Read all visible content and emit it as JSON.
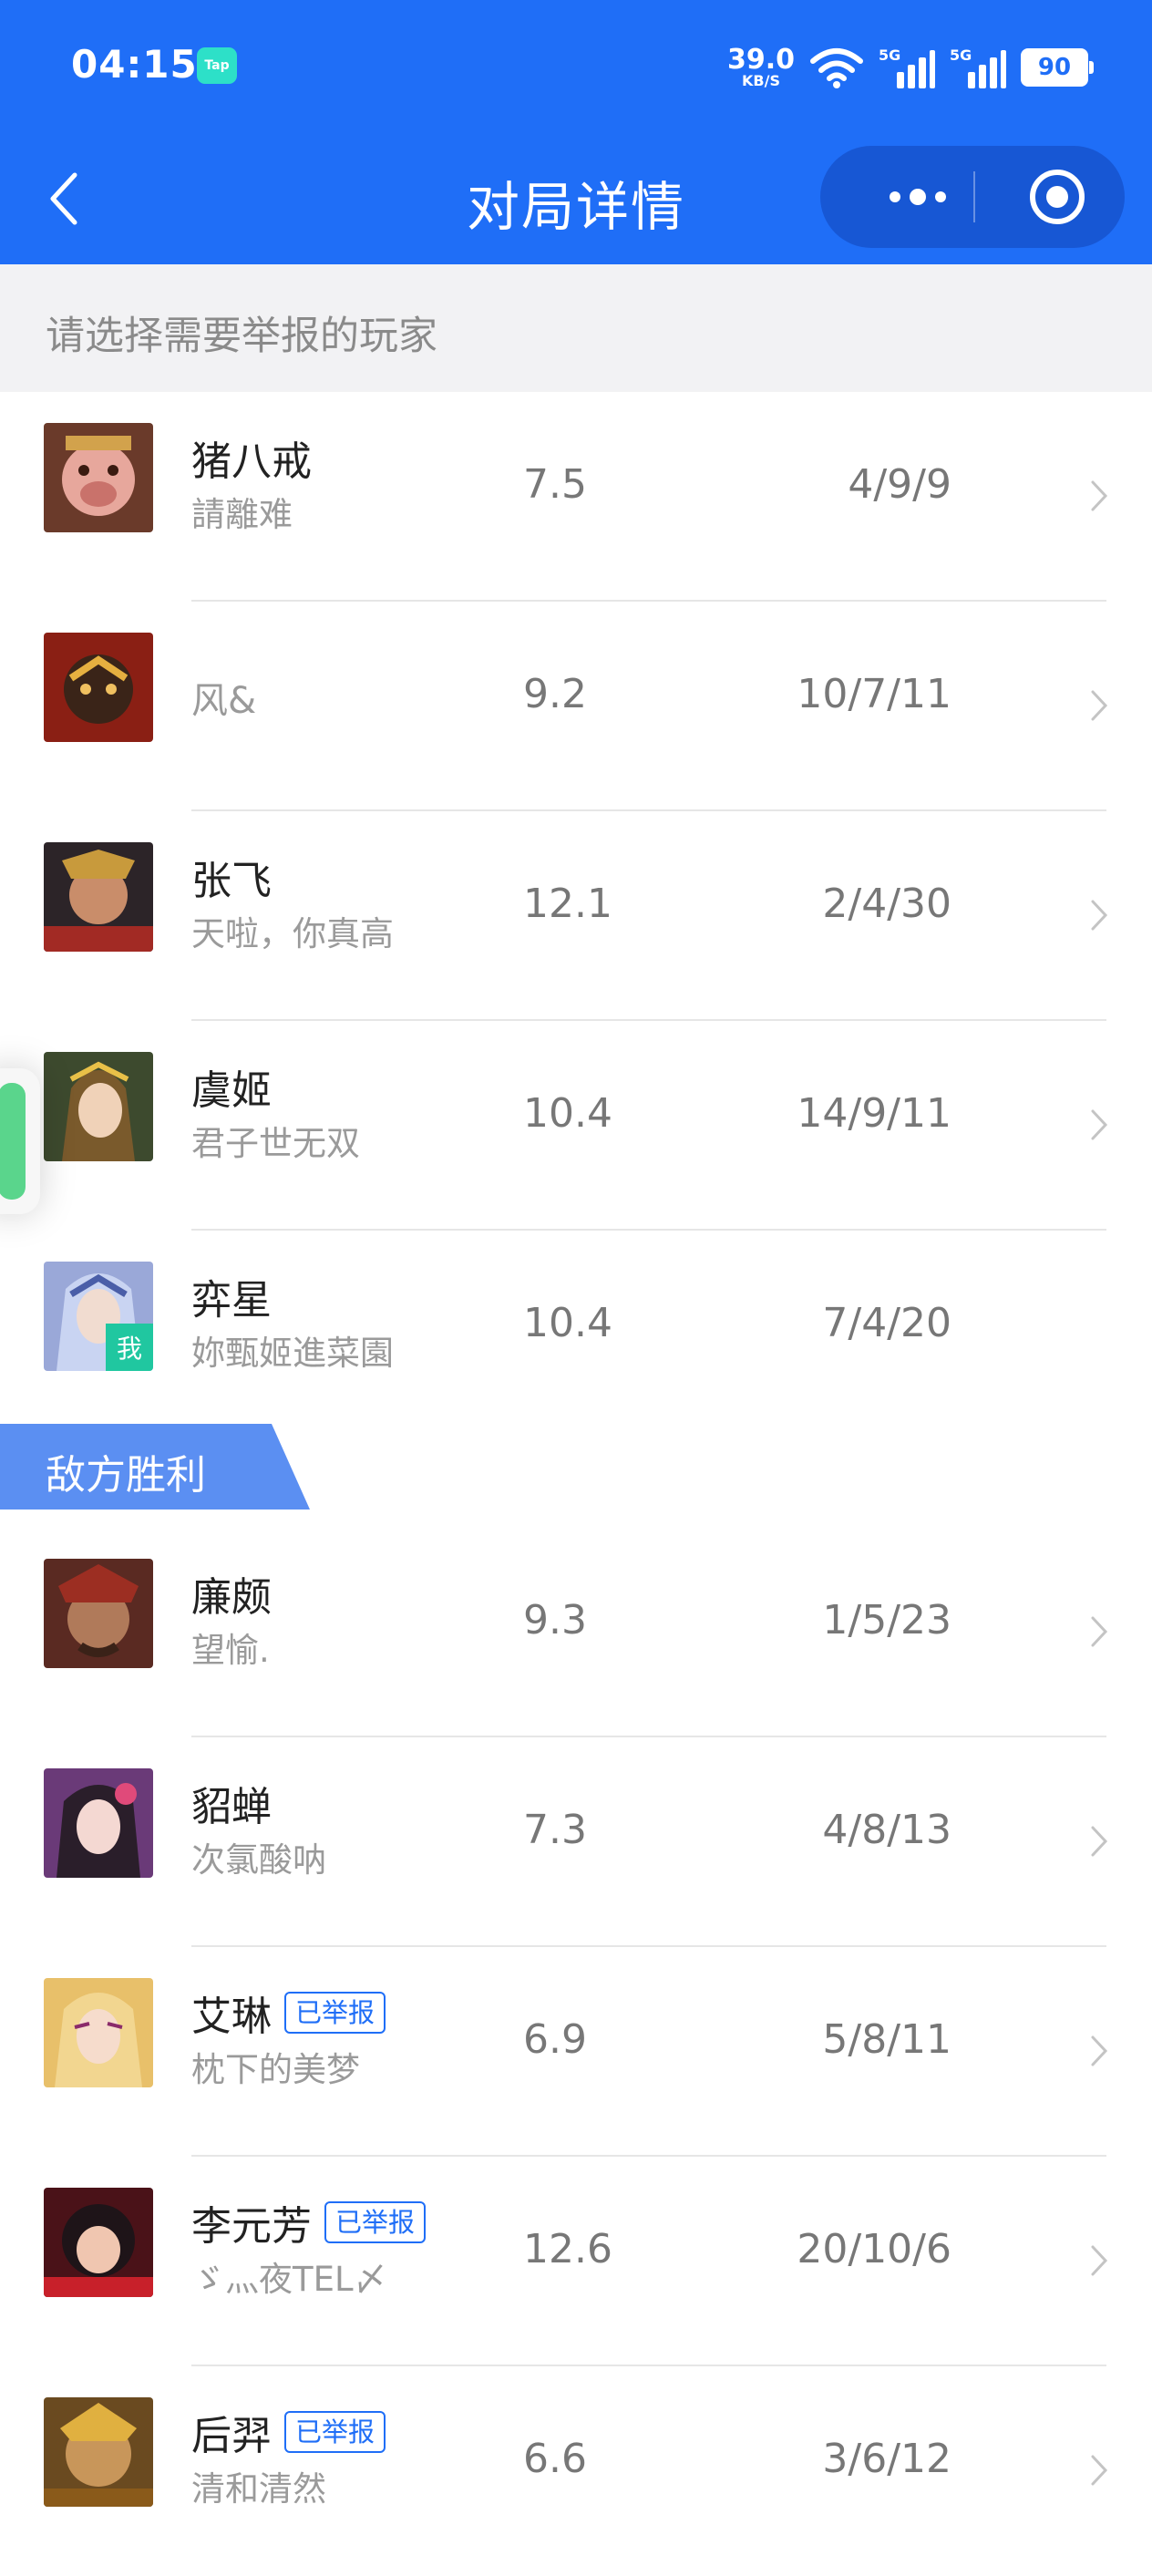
{
  "status_bar": {
    "time": "04:15",
    "app_badge": "Tap",
    "net_speed": "39.0",
    "net_unit": "KB/S",
    "signal1_label": "5G",
    "signal2_label": "5G",
    "battery": "90",
    "icons": [
      "wifi-icon",
      "signal-icon",
      "signal-icon",
      "battery-icon"
    ]
  },
  "nav": {
    "title": "对局详情",
    "back_icon": "chevron-left-icon",
    "more_icon": "more-dots-icon",
    "close_icon": "target-circle-icon"
  },
  "prompt": "请选择需要举报的玩家",
  "team_label": "敌方胜利",
  "colors": {
    "primary": "#1f6ef7",
    "capsule": "#1757d4",
    "team_tag": "#5b8ff2",
    "me_badge": "#20c7a0",
    "reported": "#1f6ef7"
  },
  "my_team": [
    {
      "hero": "猪八戒",
      "player": "請離难",
      "score": "7.5",
      "kda": "4/9/9"
    },
    {
      "hero": "",
      "player": "风&",
      "score": "9.2",
      "kda": "10/7/11"
    },
    {
      "hero": "张飞",
      "player": "天啦，你真高",
      "score": "12.1",
      "kda": "2/4/30"
    },
    {
      "hero": "虞姬",
      "player": "君子世无双",
      "score": "10.4",
      "kda": "14/9/11"
    },
    {
      "hero": "弈星",
      "player": "妳甄姬進菜園",
      "score": "10.4",
      "kda": "7/4/20",
      "me_badge": "我"
    }
  ],
  "enemy_team": [
    {
      "hero": "廉颇",
      "player": "望愉.",
      "score": "9.3",
      "kda": "1/5/23"
    },
    {
      "hero": "貂蝉",
      "player": "次氯酸呐",
      "score": "7.3",
      "kda": "4/8/13"
    },
    {
      "hero": "艾琳",
      "player": "枕下的美梦",
      "score": "6.9",
      "kda": "5/8/11",
      "reported": "已举报"
    },
    {
      "hero": "李元芳",
      "player": "ゞ灬夜TEL〆",
      "score": "12.6",
      "kda": "20/10/6",
      "reported": "已举报"
    },
    {
      "hero": "后羿",
      "player": "清和清然",
      "score": "6.6",
      "kda": "3/6/12",
      "reported": "已举报"
    }
  ]
}
